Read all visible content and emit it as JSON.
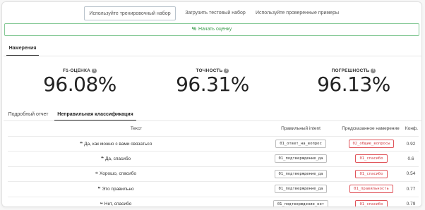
{
  "source_tabs": [
    {
      "label": "Используйте тренировочный набор",
      "active": true
    },
    {
      "label": "Загрузить тестовый набор",
      "active": false
    },
    {
      "label": "Используйте проверенные примеры",
      "active": false
    }
  ],
  "start_button": {
    "icon": "%",
    "label": "Начать оценку"
  },
  "measurements_tab": "Намерения",
  "metrics": [
    {
      "label": "F1-ОЦЕНКА",
      "value": "96.08%"
    },
    {
      "label": "ТОЧНОСТЬ",
      "value": "96.31%"
    },
    {
      "label": "ПОГРЕШНОСТЬ",
      "value": "96.13%"
    }
  ],
  "help_icon": "?",
  "report_tabs": [
    {
      "label": "Подробный отчет",
      "active": false
    },
    {
      "label": "Неправильная классификация",
      "active": true
    }
  ],
  "table": {
    "headers": {
      "text": "Текст",
      "true_intent": "Правильный intent",
      "predicted": "Предсказанное намерение",
      "conf": "Конф."
    },
    "quote_glyph": "❝",
    "rows": [
      {
        "text": "Да, как можно с вами связаться",
        "true_intent": "01_ответ_на_вопрос",
        "predicted": "02_общие_вопросы",
        "conf": "0.92"
      },
      {
        "text": "Да, спасибо",
        "true_intent": "01_подтверждение_да",
        "predicted": "01_спасибо",
        "conf": "0.6"
      },
      {
        "text": "Хорошо, спасибо",
        "true_intent": "01_подтверждение_да",
        "predicted": "01_спасибо",
        "conf": "0.54"
      },
      {
        "text": "Это правильно",
        "true_intent": "01_подтверждение_да",
        "predicted": "01_правильность",
        "conf": "0.77"
      },
      {
        "text": "Нет, спасибо",
        "true_intent": "01_подтверждение_нет",
        "predicted": "01_спасибо",
        "conf": "0.79"
      }
    ]
  }
}
